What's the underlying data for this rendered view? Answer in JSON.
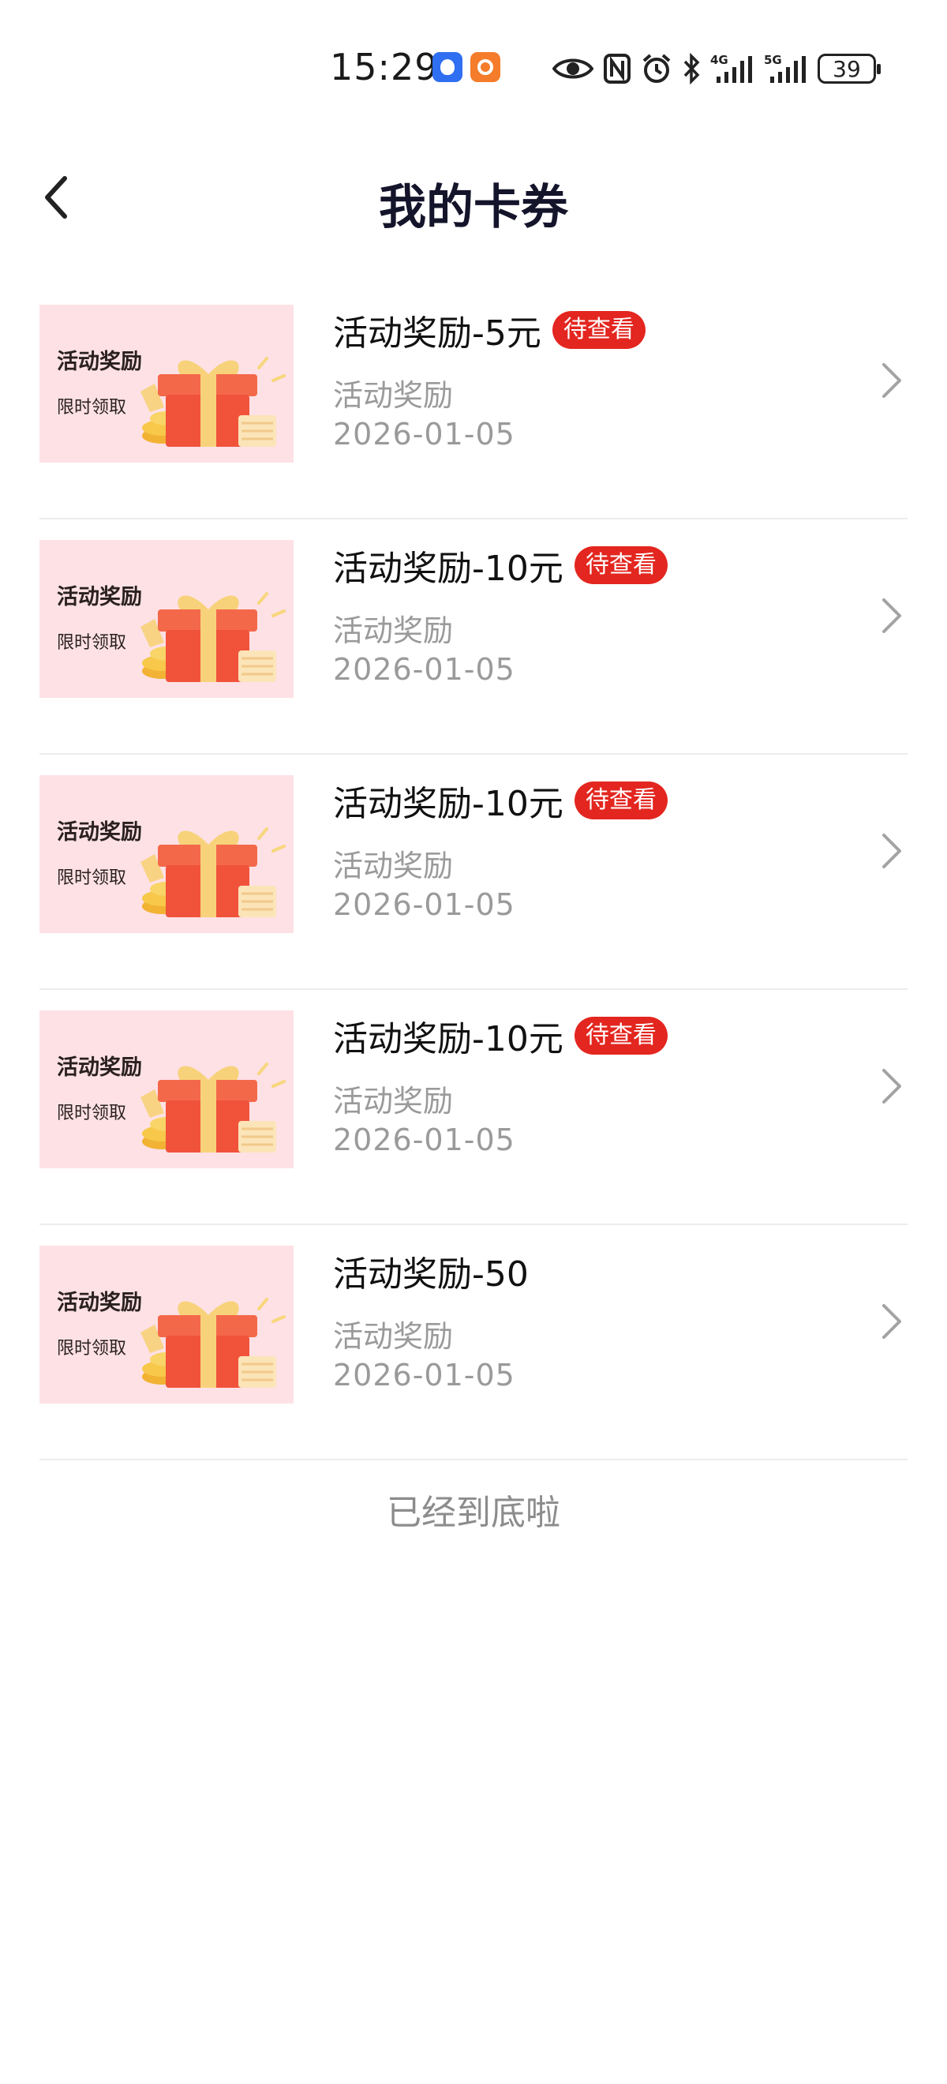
{
  "status_bar": {
    "time": "15:29",
    "battery": "39",
    "network_1": "4G",
    "network_2": "5G",
    "icons": [
      "app-blue-icon",
      "app-orange-icon",
      "eye-icon",
      "nfc-icon",
      "alarm-icon",
      "bluetooth-icon",
      "signal-4g-icon",
      "signal-5g-icon",
      "battery-icon"
    ]
  },
  "header": {
    "title": "我的卡券",
    "back_icon": "chevron-left-icon"
  },
  "colors": {
    "badge": "#e3261f",
    "thumb_bg": "#fde1e5",
    "secondary_text": "#9a9a9a"
  },
  "coupons": [
    {
      "title": "活动奖励-5元",
      "badge": "待查看",
      "subtitle": "活动奖励",
      "date": "2026-01-05",
      "thumb_title": "活动奖励",
      "thumb_sub": "限时领取"
    },
    {
      "title": "活动奖励-10元",
      "badge": "待查看",
      "subtitle": "活动奖励",
      "date": "2026-01-05",
      "thumb_title": "活动奖励",
      "thumb_sub": "限时领取"
    },
    {
      "title": "活动奖励-10元",
      "badge": "待查看",
      "subtitle": "活动奖励",
      "date": "2026-01-05",
      "thumb_title": "活动奖励",
      "thumb_sub": "限时领取"
    },
    {
      "title": "活动奖励-10元",
      "badge": "待查看",
      "subtitle": "活动奖励",
      "date": "2026-01-05",
      "thumb_title": "活动奖励",
      "thumb_sub": "限时领取"
    },
    {
      "title": "活动奖励-50",
      "badge": "",
      "subtitle": "活动奖励",
      "date": "2026-01-05",
      "thumb_title": "活动奖励",
      "thumb_sub": "限时领取"
    }
  ],
  "footer": {
    "end_text": "已经到底啦"
  }
}
